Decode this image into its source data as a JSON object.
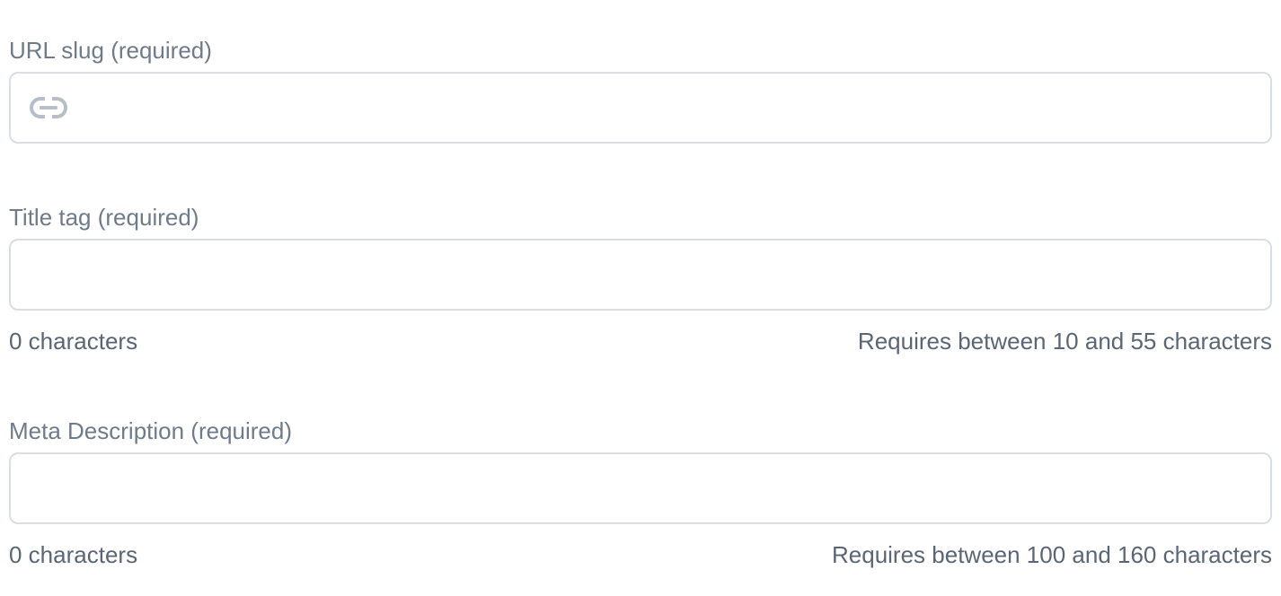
{
  "url_slug": {
    "label": "URL slug (required)",
    "value": "",
    "placeholder": "",
    "icon": "link-icon"
  },
  "title_tag": {
    "label": "Title tag (required)",
    "value": "",
    "placeholder": "",
    "count_text": "0 characters",
    "requirement_text": "Requires between 10 and 55 characters"
  },
  "meta_description": {
    "label": "Meta Description (required)",
    "value": "",
    "placeholder": "",
    "count_text": "0 characters",
    "requirement_text": "Requires between 100 and 160 characters"
  },
  "colors": {
    "label_text": "#6f7b8a",
    "helper_text": "#5a6675",
    "input_border": "#d9dee4",
    "icon": "#b7bec7"
  }
}
